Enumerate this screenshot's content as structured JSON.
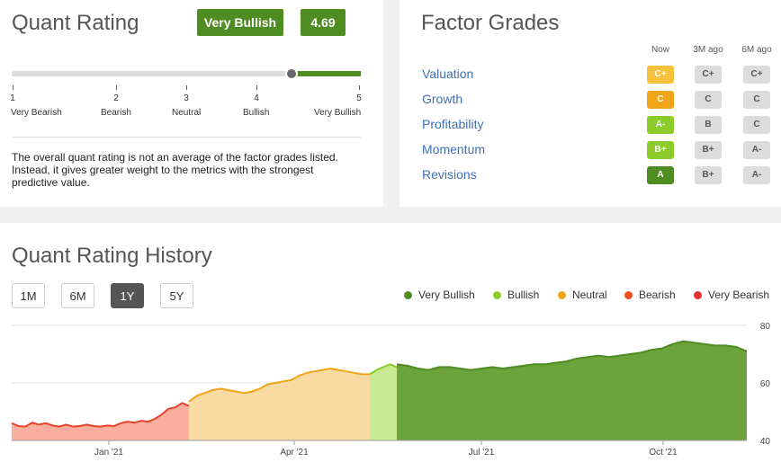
{
  "quant": {
    "title": "Quant Rating",
    "rating_label": "Very Bullish",
    "score": "4.69",
    "score_value": 4.69,
    "scale": [
      {
        "num": "1",
        "label": "Very Bearish"
      },
      {
        "num": "2",
        "label": "Bearish"
      },
      {
        "num": "3",
        "label": "Neutral"
      },
      {
        "num": "4",
        "label": "Bullish"
      },
      {
        "num": "5",
        "label": "Very Bullish"
      }
    ],
    "description": "The overall quant rating is not an average of the factor grades listed. Instead, it gives greater weight to the metrics with the strongest predictive value."
  },
  "factors": {
    "title": "Factor Grades",
    "columns": [
      "Now",
      "3M ago",
      "6M ago"
    ],
    "rows": [
      {
        "name": "Valuation",
        "grades": [
          "C+",
          "C+",
          "C+"
        ]
      },
      {
        "name": "Growth",
        "grades": [
          "C",
          "C",
          "C"
        ]
      },
      {
        "name": "Profitability",
        "grades": [
          "A-",
          "B",
          "C"
        ]
      },
      {
        "name": "Momentum",
        "grades": [
          "B+",
          "B+",
          "A-"
        ]
      },
      {
        "name": "Revisions",
        "grades": [
          "A",
          "B+",
          "A-"
        ]
      }
    ],
    "now_colors": [
      "#f7c13c",
      "#f0a418",
      "#8ccc2a",
      "#8ccc2a",
      "#4f8c22"
    ]
  },
  "history": {
    "title": "Quant Rating History",
    "ranges": [
      "1M",
      "6M",
      "1Y",
      "5Y"
    ],
    "active_range": "1Y",
    "legend": [
      {
        "label": "Very Bullish",
        "color": "#4f8c22"
      },
      {
        "label": "Bullish",
        "color": "#8ccc2a"
      },
      {
        "label": "Neutral",
        "color": "#f0a418"
      },
      {
        "label": "Bearish",
        "color": "#f04e1a"
      },
      {
        "label": "Very Bearish",
        "color": "#e03030"
      }
    ]
  },
  "chart_data": {
    "type": "area",
    "x_labels": [
      "Jan '21",
      "Apr '21",
      "Jul '21",
      "Oct '21"
    ],
    "y_ticks": [
      "80",
      "60",
      "40"
    ],
    "ylim": [
      40,
      80
    ],
    "grid": true,
    "segments": [
      {
        "rating": "Bearish",
        "color_fill": "#fcae9e",
        "color_line": "#e8432a",
        "values": [
          46.0,
          45.0,
          44.8,
          46.2,
          45.5,
          46.0,
          45.2,
          44.8,
          45.5,
          44.8,
          45.0,
          45.5,
          45.0,
          44.8,
          45.2,
          45.0,
          46.0,
          46.5,
          46.2,
          46.8,
          46.5,
          47.5,
          49.0,
          51.0,
          51.5,
          53.0,
          52.0
        ]
      },
      {
        "rating": "Neutral",
        "color_fill": "#f8dba3",
        "color_line": "#f0a418",
        "values": [
          53.5,
          55.5,
          56.5,
          57.5,
          58.0,
          57.5,
          57.0,
          56.5,
          57.0,
          58.0,
          59.5,
          60.0,
          60.5,
          61.0,
          62.5,
          63.5,
          64.0,
          64.5,
          65.0,
          64.5,
          64.0,
          63.5,
          63.0,
          63.0
        ]
      },
      {
        "rating": "Bullish",
        "color_fill": "#c8ea92",
        "color_line": "#8ccc2a",
        "values": [
          63.0,
          64.5,
          65.5,
          66.5,
          65.5
        ]
      },
      {
        "rating": "Very Bullish",
        "color_fill": "#6aa43a",
        "color_line": "#4f8c22",
        "values": [
          66.5,
          66.0,
          65.0,
          64.5,
          65.5,
          65.5,
          65.0,
          64.5,
          65.0,
          65.5,
          65.0,
          65.5,
          66.0,
          66.5,
          66.5,
          67.0,
          67.5,
          68.5,
          69.0,
          69.5,
          69.0,
          69.5,
          70.0,
          70.5,
          71.5,
          72.0,
          73.5,
          74.5,
          74.0,
          73.5,
          73.0,
          73.0,
          72.5,
          71.0
        ]
      }
    ]
  }
}
